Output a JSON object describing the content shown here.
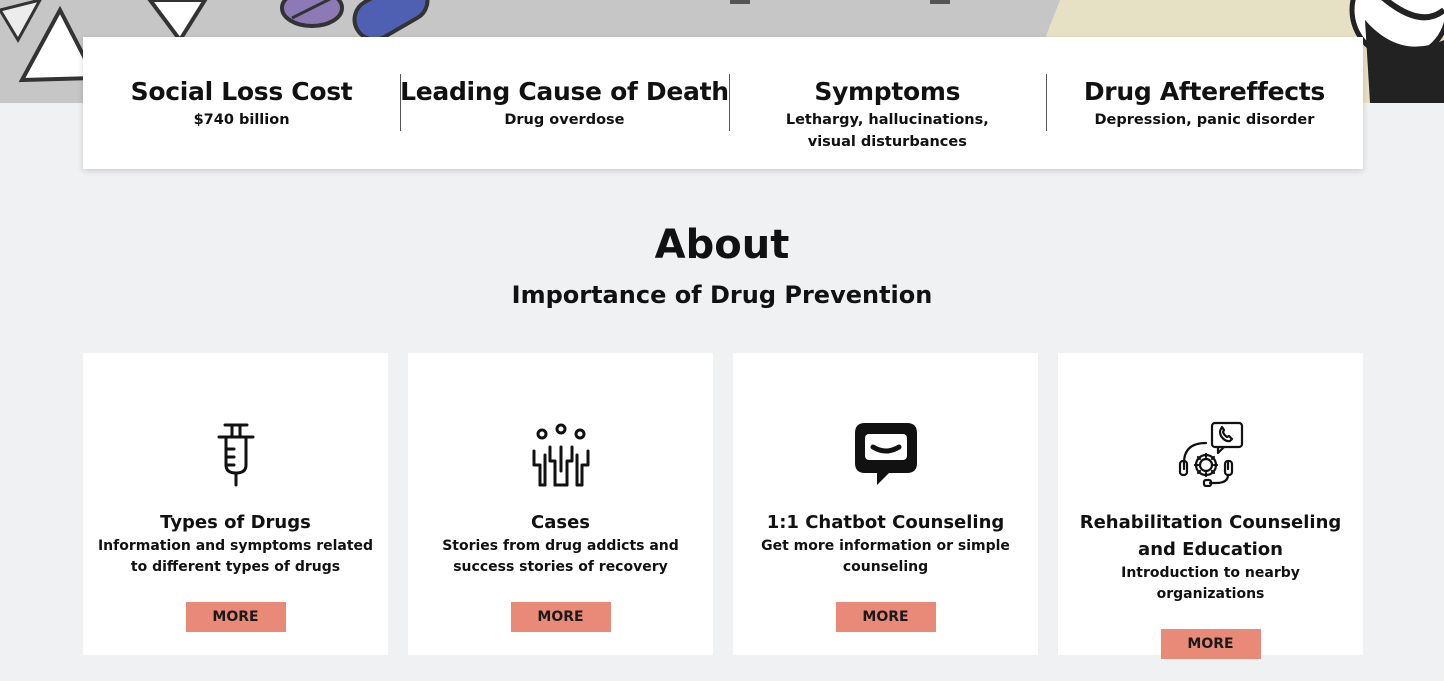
{
  "stats": [
    {
      "title": "Social Loss Cost",
      "value": "$740 billion"
    },
    {
      "title": "Leading Cause of Death",
      "value": "Drug overdose"
    },
    {
      "title": "Symptoms",
      "value": "Lethargy, hallucinations, visual disturbances"
    },
    {
      "title": "Drug Aftereffects",
      "value": "Depression, panic disorder"
    }
  ],
  "about": {
    "title": "About",
    "subtitle": "Importance of Drug Prevention"
  },
  "cards": [
    {
      "icon": "syringe-icon",
      "title": "Types of Drugs",
      "description": "Information and symptoms related to different types of drugs",
      "button_label": "MORE"
    },
    {
      "icon": "people-stories-icon",
      "title": "Cases",
      "description": "Stories from drug addicts and success stories of recovery",
      "button_label": "MORE"
    },
    {
      "icon": "chat-bubble-icon",
      "title": "1:1 Chatbot Counseling",
      "description": "Get more information or simple counseling",
      "button_label": "MORE"
    },
    {
      "icon": "headset-support-icon",
      "title": "Rehabilitation Counseling and Education",
      "description": "Introduction to nearby organizations",
      "button_label": "MORE"
    }
  ],
  "colors": {
    "page_background": "#f0f1f3",
    "card_background": "#ffffff",
    "button_background": "#e98a79",
    "text": "#111111"
  }
}
